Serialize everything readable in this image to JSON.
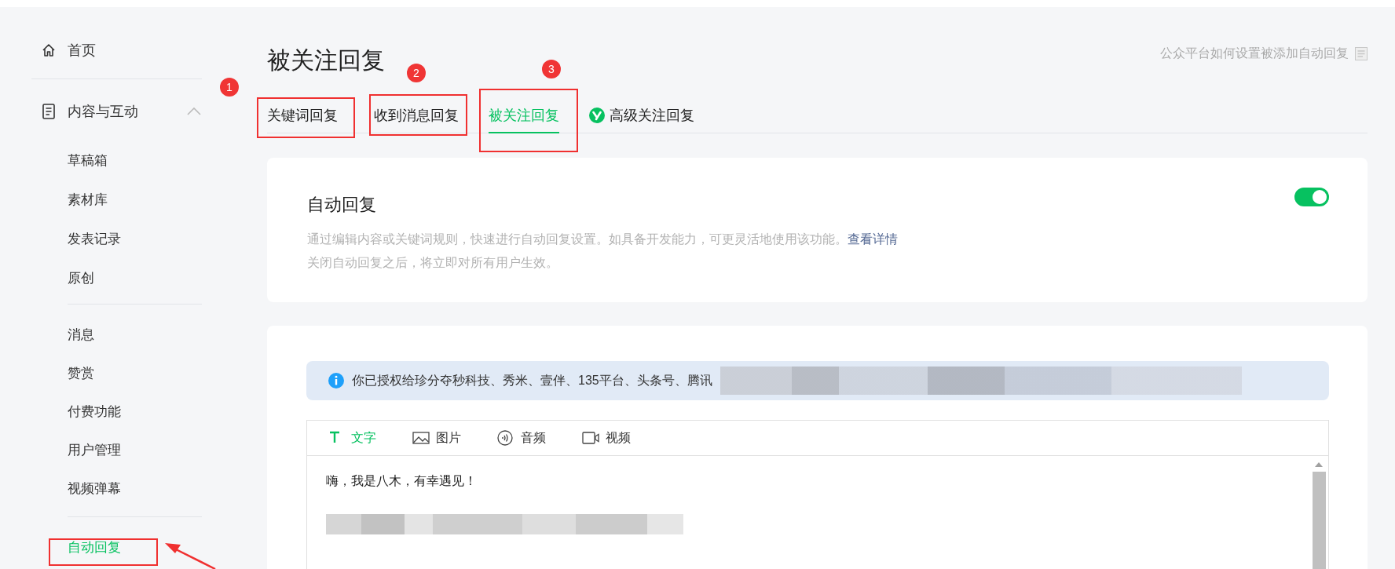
{
  "sidebar": {
    "home": {
      "label": "首页"
    },
    "section": {
      "label": "内容与互动",
      "expanded": true,
      "groups": [
        [
          {
            "label": "草稿箱",
            "selected": false
          },
          {
            "label": "素材库",
            "selected": false
          },
          {
            "label": "发表记录",
            "selected": false
          },
          {
            "label": "原创",
            "selected": false
          }
        ],
        [
          {
            "label": "消息",
            "selected": false
          },
          {
            "label": "赞赏",
            "selected": false
          },
          {
            "label": "付费功能",
            "selected": false
          },
          {
            "label": "用户管理",
            "selected": false
          },
          {
            "label": "视频弹幕",
            "selected": false
          }
        ],
        [
          {
            "label": "自动回复",
            "selected": true
          }
        ]
      ]
    }
  },
  "page": {
    "title": "被关注回复",
    "help_link": "公众平台如何设置被添加自动回复"
  },
  "tabs": [
    {
      "label": "关键词回复",
      "selected": false,
      "kind": "plain"
    },
    {
      "label": "收到消息回复",
      "selected": false,
      "kind": "plain"
    },
    {
      "label": "被关注回复",
      "selected": true,
      "kind": "plain"
    },
    {
      "label": "高级关注回复",
      "selected": false,
      "kind": "premium"
    }
  ],
  "auto_reply_card": {
    "title": "自动回复",
    "on": true,
    "description": "通过编辑内容或关键词规则，快速进行自动回复设置。如具备开发能力，可更灵活地使用该功能。",
    "link": "查看详情",
    "note": "关闭自动回复之后，将立即对所有用户生效。"
  },
  "reply_editor": {
    "notice": "你已授权给珍分夺秒科技、秀米、壹伴、135平台、头条号、腾讯",
    "media_tabs": [
      {
        "label": "文字",
        "selected": true,
        "kind": "text"
      },
      {
        "label": "图片",
        "selected": false,
        "kind": "image"
      },
      {
        "label": "音频",
        "selected": false,
        "kind": "audio"
      },
      {
        "label": "视频",
        "selected": false,
        "kind": "video"
      }
    ],
    "content": [
      "嗨，我是八木，有幸遇见！"
    ]
  },
  "annotations": [
    {
      "label": "1"
    },
    {
      "label": "2"
    },
    {
      "label": "3"
    }
  ]
}
